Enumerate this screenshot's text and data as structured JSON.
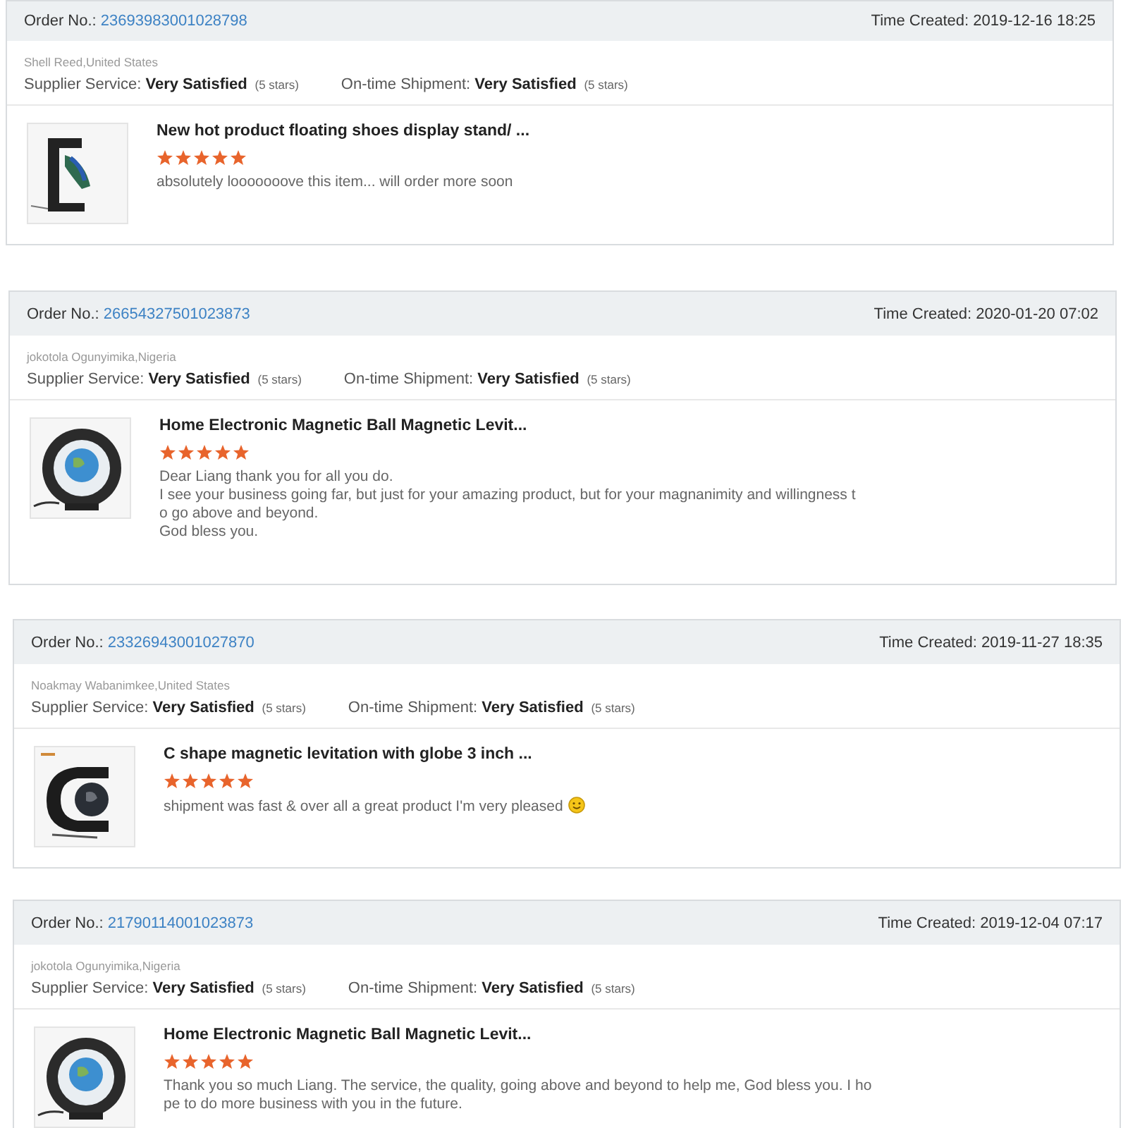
{
  "orders": [
    {
      "order_label": "Order No.:",
      "order_no": "23693983001028798",
      "time_created": "Time Created: 2019-12-16 18:25",
      "buyer": "Shell Reed,United States",
      "ratings": [
        {
          "label": "Supplier Service:",
          "value": "Very Satisfied",
          "stars_text": "(5 stars)"
        },
        {
          "label": "On-time Shipment:",
          "value": "Very Satisfied",
          "stars_text": "(5 stars)"
        }
      ],
      "product": {
        "title": "New hot product floating shoes display stand/ ...",
        "stars": 5,
        "review_lines": [
          "absolutely looooooove this item... will order more soon"
        ]
      }
    },
    {
      "order_label": "Order No.:",
      "order_no": "26654327501023873",
      "time_created": "Time Created: 2020-01-20 07:02",
      "buyer": "jokotola Ogunyimika,Nigeria",
      "ratings": [
        {
          "label": "Supplier Service:",
          "value": "Very Satisfied",
          "stars_text": "(5 stars)"
        },
        {
          "label": "On-time Shipment:",
          "value": "Very Satisfied",
          "stars_text": "(5 stars)"
        }
      ],
      "product": {
        "title": "Home Electronic Magnetic Ball Magnetic Levit...",
        "stars": 5,
        "review_lines": [
          "Dear Liang thank you for all you do.",
          "I see your business going far, but just for your amazing product, but for your magnanimity and willingness t",
          "o go above and beyond.",
          "God bless you."
        ]
      }
    },
    {
      "order_label": "Order No.:",
      "order_no": "23326943001027870",
      "time_created": "Time Created: 2019-11-27 18:35",
      "buyer": "Noakmay Wabanimkee,United States",
      "ratings": [
        {
          "label": "Supplier Service:",
          "value": "Very Satisfied",
          "stars_text": "(5 stars)"
        },
        {
          "label": "On-time Shipment:",
          "value": "Very Satisfied",
          "stars_text": "(5 stars)"
        }
      ],
      "product": {
        "title": "C shape magnetic levitation with globe 3 inch ...",
        "stars": 5,
        "review_lines": [
          "shipment was fast & over all a great product I'm very pleased"
        ],
        "smiley": true
      }
    },
    {
      "order_label": "Order No.:",
      "order_no": "21790114001023873",
      "time_created": "Time Created: 2019-12-04 07:17",
      "buyer": "jokotola Ogunyimika,Nigeria",
      "ratings": [
        {
          "label": "Supplier Service:",
          "value": "Very Satisfied",
          "stars_text": "(5 stars)"
        },
        {
          "label": "On-time Shipment:",
          "value": "Very Satisfied",
          "stars_text": "(5 stars)"
        }
      ],
      "product": {
        "title": "Home Electronic Magnetic Ball Magnetic Levit...",
        "stars": 5,
        "review_lines": [
          "Thank you so much Liang. The service, the quality, going above and beyond to help me, God bless you. I ho",
          "pe to do more business with you in the future."
        ]
      }
    }
  ]
}
